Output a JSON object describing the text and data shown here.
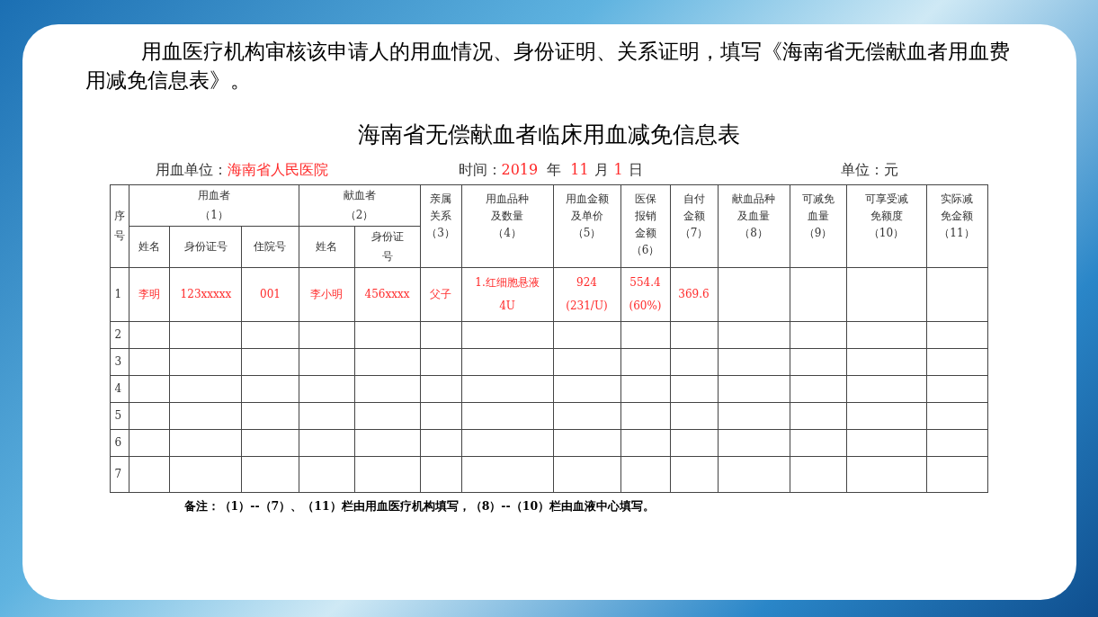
{
  "intro": "用血医疗机构审核该申请人的用血情况、身份证明、关系证明，填写《海南省无偿献血者用血费用减免信息表》。",
  "form": {
    "title": "海南省无偿献血者临床用血减免信息表",
    "unit_label": "用血单位：",
    "unit_value": "海南省人民医院",
    "time_label": "时间：",
    "year": "2019",
    "year_label": "年",
    "month": "11",
    "month_label": "月",
    "day": "1",
    "day_label": "日",
    "currency": "单位：元",
    "header_index": [
      "序",
      "号"
    ],
    "groups": [
      {
        "label": [
          "用血者",
          "（1）"
        ],
        "sub": [
          [
            "姓名"
          ],
          [
            "身份证号"
          ],
          [
            "住院号"
          ]
        ]
      },
      {
        "label": [
          "献血者",
          "（2）"
        ],
        "sub": [
          [
            "姓名"
          ],
          [
            "身份证",
            "号"
          ]
        ]
      }
    ],
    "columns": [
      [
        "亲属",
        "关系",
        "（3）"
      ],
      [
        "用血品种",
        "及数量",
        "（4）"
      ],
      [
        "用血金额",
        "及单价",
        "（5）"
      ],
      [
        "医保",
        "报销",
        "金额",
        "（6）"
      ],
      [
        "自付",
        "金额",
        "（7）"
      ],
      [
        "献血品种",
        "及血量",
        "（8）"
      ],
      [
        "可减免",
        "血量",
        "（9）"
      ],
      [
        "可享受减",
        "免额度",
        "（10）"
      ],
      [
        "实际减",
        "免金额",
        "（11）"
      ]
    ],
    "rows": [
      {
        "no": "1",
        "cells": [
          [
            "李明"
          ],
          [
            "123xxxxx"
          ],
          [
            "001"
          ],
          [
            "李小明"
          ],
          [
            "456xxxx"
          ],
          [
            "父子"
          ],
          [
            "1.红细胞悬液",
            "4U"
          ],
          [
            "924",
            "(231/U)"
          ],
          [
            "554.4",
            "(60%)"
          ],
          [
            "369.6"
          ]
        ]
      },
      {
        "no": "2"
      },
      {
        "no": "3"
      },
      {
        "no": "4"
      },
      {
        "no": "5"
      },
      {
        "no": "6"
      },
      {
        "no": "7"
      }
    ],
    "note": "备注：（1）--（7）、（11）栏由用血医疗机构填写，（8）--（10）栏由血液中心填写。"
  }
}
